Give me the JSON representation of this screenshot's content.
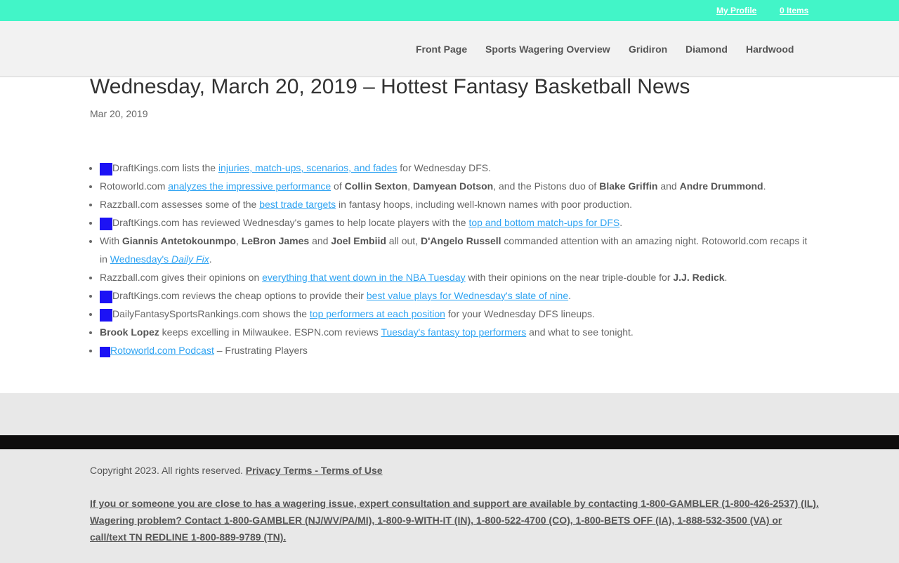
{
  "topbar": {
    "profile": "My Profile",
    "items": "0 Items"
  },
  "nav": [
    "Front Page",
    "Sports Wagering Overview",
    "Gridiron",
    "Diamond",
    "Hardwood"
  ],
  "article": {
    "title": "Wednesday, March 20, 2019 – Hottest Fantasy Basketball News",
    "date": "Mar 20, 2019"
  },
  "news": {
    "i1": {
      "a": "DraftKings.com lists the ",
      "link": "injuries, match-ups, scenarios, and fades",
      "b": " for Wednesday DFS."
    },
    "i2": {
      "a": "Rotoworld.com ",
      "link": "analyzes the impressive performance",
      "b": " of ",
      "p1": "Collin Sexton",
      "c": ", ",
      "p2": "Damyean Dotson",
      "d": ", and the Pistons duo of ",
      "p3": "Blake Griffin",
      "e": " and ",
      "p4": "Andre Drummond",
      "f": "."
    },
    "i3": {
      "a": "Razzball.com assesses some of the ",
      "link": "best trade targets",
      "b": " in fantasy hoops, including well-known names with poor production."
    },
    "i4": {
      "a": "DraftKings.com has reviewed Wednesday's games to help locate players with the ",
      "link": "top and bottom match-ups for DFS",
      "b": "."
    },
    "i5": {
      "a": "With ",
      "p1": "Giannis Antetokounmpo",
      "b": ", ",
      "p2": "LeBron James",
      "c": " and ",
      "p3": "Joel Embiid",
      "d": " all out, ",
      "p4": "D'Angelo Russell",
      "e": " commanded attention with an amazing night. Rotoworld.com recaps it in ",
      "link": "Wednesday's ",
      "link_em": "Daily Fix",
      "f": "."
    },
    "i6": {
      "a": "Razzball.com gives their opinions on ",
      "link": "everything that went down in the NBA Tuesday",
      "b": " with their opinions on the near triple-double for ",
      "p1": "J.J. Redick",
      "c": "."
    },
    "i7": {
      "a": "DraftKings.com reviews the cheap options to provide their ",
      "link": "best value plays for Wednesday's slate of nine",
      "b": "."
    },
    "i8": {
      "a": "DailyFantasySportsRankings.com shows the ",
      "link": "top performers at each position",
      "b": " for your Wednesday DFS lineups."
    },
    "i9": {
      "p1": "Brook Lopez",
      "a": " keeps excelling in Milwaukee. ESPN.com reviews ",
      "link": "Tuesday's fantasy top performers",
      "b": " and what to see tonight."
    },
    "i10": {
      "link": "Rotoworld.com Podcast",
      "a": " – Frustrating Players"
    }
  },
  "footer": {
    "copyright": "Copyright 2023. All rights reserved. ",
    "terms_link": "Privacy Terms - Terms of Use",
    "warning": "If you or someone you are close to has a wagering issue, expert consultation and support are available by contacting 1-800-GAMBLER (1-800-426-2537) (IL). Wagering problem? Contact 1-800-GAMBLER (NJ/WV/PA/MI), 1-800-9-WITH-IT (IN), 1-800-522-4700 (CO), 1-800-BETS OFF (IA), 1-888-532-3500 (VA) or call/text TN REDLINE 1-800-889-9789 (TN)."
  },
  "colors": {
    "topbar": "#42f5c8",
    "link": "#2ea3f2",
    "broken_image": "#1c12f5",
    "footer_bg": "#e8e8e8"
  },
  "icons": {
    "broken_image": "broken-image-icon"
  }
}
